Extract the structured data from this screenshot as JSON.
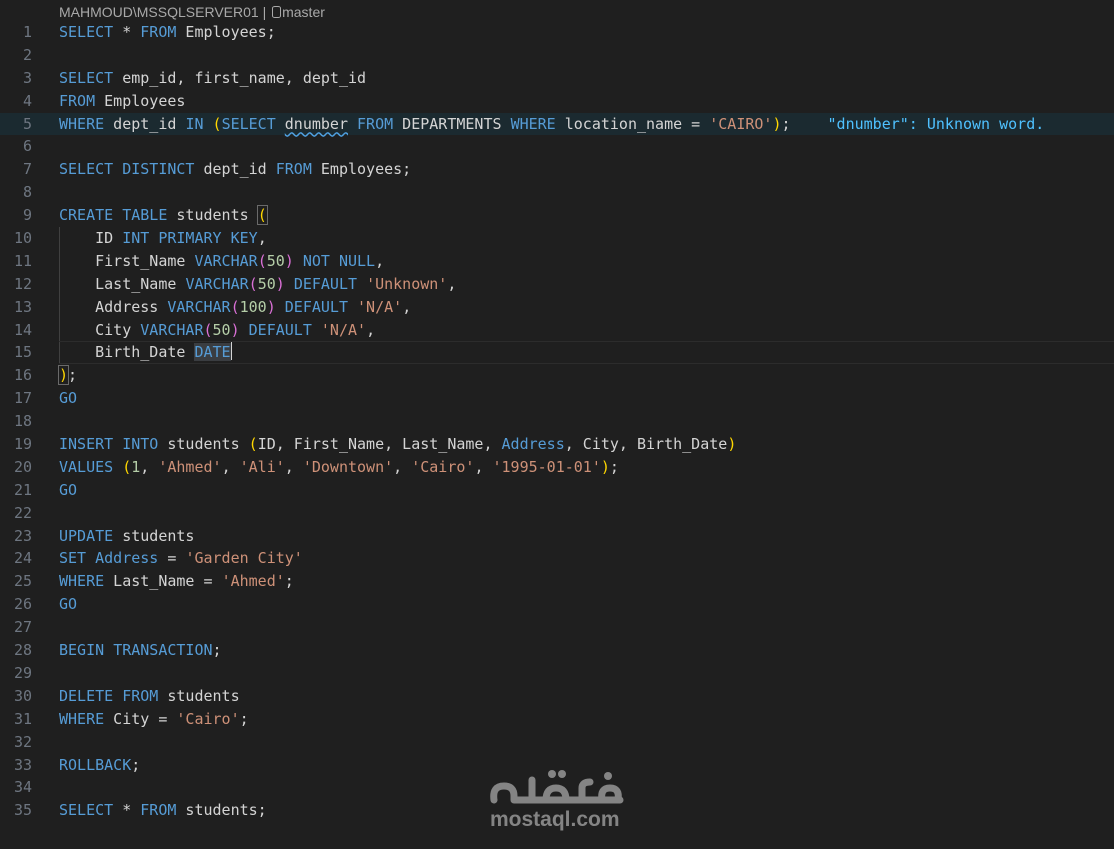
{
  "connection": {
    "server": "MAHMOUD\\MSSQLSERVER01",
    "separator": "|",
    "database": "master"
  },
  "watermark": {
    "brand_glyphs": "مستقل",
    "domain": "mostaql.com"
  },
  "editor": {
    "active_line": 5,
    "cursor_line": 15,
    "diagnostic": "\"dnumber\": Unknown word.",
    "lines": [
      {
        "n": "1",
        "tokens": [
          [
            "kw",
            "SELECT"
          ],
          [
            "op",
            " * "
          ],
          [
            "kw",
            "FROM"
          ],
          [
            "id",
            " Employees;"
          ]
        ]
      },
      {
        "n": "2",
        "tokens": []
      },
      {
        "n": "3",
        "tokens": [
          [
            "kw",
            "SELECT"
          ],
          [
            "id",
            " emp_id, first_name, dept_id"
          ]
        ]
      },
      {
        "n": "4",
        "tokens": [
          [
            "kw",
            "FROM"
          ],
          [
            "id",
            " Employees"
          ]
        ]
      },
      {
        "n": "5",
        "tokens": [
          [
            "kw",
            "WHERE"
          ],
          [
            "id",
            " dept_id "
          ],
          [
            "kw",
            "IN"
          ],
          [
            "op",
            " "
          ],
          [
            "br1",
            "("
          ],
          [
            "kw",
            "SELECT"
          ],
          [
            "op",
            " "
          ],
          [
            "squiggle",
            "dnumber"
          ],
          [
            "op",
            " "
          ],
          [
            "kw",
            "FROM"
          ],
          [
            "id",
            " DEPARTMENTS "
          ],
          [
            "kw",
            "WHERE"
          ],
          [
            "id",
            " location_name = "
          ],
          [
            "str",
            "'CAIRO'"
          ],
          [
            "br1",
            ")"
          ],
          [
            "op",
            ";"
          ]
        ],
        "diag": true
      },
      {
        "n": "6",
        "tokens": []
      },
      {
        "n": "7",
        "tokens": [
          [
            "kw",
            "SELECT"
          ],
          [
            "op",
            " "
          ],
          [
            "kw",
            "DISTINCT"
          ],
          [
            "id",
            " dept_id "
          ],
          [
            "kw",
            "FROM"
          ],
          [
            "id",
            " Employees;"
          ]
        ]
      },
      {
        "n": "8",
        "tokens": []
      },
      {
        "n": "9",
        "tokens": [
          [
            "kw",
            "CREATE"
          ],
          [
            "op",
            " "
          ],
          [
            "kw",
            "TABLE"
          ],
          [
            "id",
            " students "
          ],
          [
            "brmatch",
            "("
          ]
        ]
      },
      {
        "n": "10",
        "tokens": [
          [
            "op",
            "    "
          ],
          [
            "id",
            "ID "
          ],
          [
            "kw",
            "INT"
          ],
          [
            "op",
            " "
          ],
          [
            "kw",
            "PRIMARY"
          ],
          [
            "op",
            " "
          ],
          [
            "kw",
            "KEY"
          ],
          [
            "op",
            ","
          ]
        ],
        "guide": true
      },
      {
        "n": "11",
        "tokens": [
          [
            "op",
            "    "
          ],
          [
            "id",
            "First_Name "
          ],
          [
            "kw",
            "VARCHAR"
          ],
          [
            "br2",
            "("
          ],
          [
            "num",
            "50"
          ],
          [
            "br2",
            ")"
          ],
          [
            "op",
            " "
          ],
          [
            "kw",
            "NOT"
          ],
          [
            "op",
            " "
          ],
          [
            "kw",
            "NULL"
          ],
          [
            "op",
            ","
          ]
        ],
        "guide": true
      },
      {
        "n": "12",
        "tokens": [
          [
            "op",
            "    "
          ],
          [
            "id",
            "Last_Name "
          ],
          [
            "kw",
            "VARCHAR"
          ],
          [
            "br2",
            "("
          ],
          [
            "num",
            "50"
          ],
          [
            "br2",
            ")"
          ],
          [
            "op",
            " "
          ],
          [
            "kw",
            "DEFAULT"
          ],
          [
            "op",
            " "
          ],
          [
            "str",
            "'Unknown'"
          ],
          [
            "op",
            ","
          ]
        ],
        "guide": true
      },
      {
        "n": "13",
        "tokens": [
          [
            "op",
            "    "
          ],
          [
            "id",
            "Address "
          ],
          [
            "kw",
            "VARCHAR"
          ],
          [
            "br2",
            "("
          ],
          [
            "num",
            "100"
          ],
          [
            "br2",
            ")"
          ],
          [
            "op",
            " "
          ],
          [
            "kw",
            "DEFAULT"
          ],
          [
            "op",
            " "
          ],
          [
            "str",
            "'N/A'"
          ],
          [
            "op",
            ","
          ]
        ],
        "guide": true
      },
      {
        "n": "14",
        "tokens": [
          [
            "op",
            "    "
          ],
          [
            "id",
            "City "
          ],
          [
            "kw",
            "VARCHAR"
          ],
          [
            "br2",
            "("
          ],
          [
            "num",
            "50"
          ],
          [
            "br2",
            ")"
          ],
          [
            "op",
            " "
          ],
          [
            "kw",
            "DEFAULT"
          ],
          [
            "op",
            " "
          ],
          [
            "str",
            "'N/A'"
          ],
          [
            "op",
            ","
          ]
        ],
        "guide": true
      },
      {
        "n": "15",
        "tokens": [
          [
            "op",
            "    "
          ],
          [
            "id",
            "Birth_Date "
          ],
          [
            "sel",
            "DATE"
          ],
          [
            "caret",
            ""
          ]
        ],
        "guide": true
      },
      {
        "n": "16",
        "tokens": [
          [
            "brmatch",
            ")"
          ],
          [
            "op",
            ";"
          ]
        ]
      },
      {
        "n": "17",
        "tokens": [
          [
            "kw",
            "GO"
          ]
        ]
      },
      {
        "n": "18",
        "tokens": []
      },
      {
        "n": "19",
        "tokens": [
          [
            "kw",
            "INSERT"
          ],
          [
            "op",
            " "
          ],
          [
            "kw",
            "INTO"
          ],
          [
            "id",
            " students "
          ],
          [
            "br1",
            "("
          ],
          [
            "id",
            "ID, First_Name, Last_Name, "
          ],
          [
            "kw",
            "Address"
          ],
          [
            "id",
            ", City, Birth_Date"
          ],
          [
            "br1",
            ")"
          ]
        ]
      },
      {
        "n": "20",
        "tokens": [
          [
            "kw",
            "VALUES"
          ],
          [
            "op",
            " "
          ],
          [
            "br1",
            "("
          ],
          [
            "num",
            "1"
          ],
          [
            "op",
            ", "
          ],
          [
            "str",
            "'Ahmed'"
          ],
          [
            "op",
            ", "
          ],
          [
            "str",
            "'Ali'"
          ],
          [
            "op",
            ", "
          ],
          [
            "str",
            "'Downtown'"
          ],
          [
            "op",
            ", "
          ],
          [
            "str",
            "'Cairo'"
          ],
          [
            "op",
            ", "
          ],
          [
            "str",
            "'1995-01-01'"
          ],
          [
            "br1",
            ")"
          ],
          [
            "op",
            ";"
          ]
        ]
      },
      {
        "n": "21",
        "tokens": [
          [
            "kw",
            "GO"
          ]
        ]
      },
      {
        "n": "22",
        "tokens": []
      },
      {
        "n": "23",
        "tokens": [
          [
            "kw",
            "UPDATE"
          ],
          [
            "id",
            " students"
          ]
        ]
      },
      {
        "n": "24",
        "tokens": [
          [
            "kw",
            "SET"
          ],
          [
            "op",
            " "
          ],
          [
            "kw",
            "Address"
          ],
          [
            "op",
            " = "
          ],
          [
            "str",
            "'Garden City'"
          ]
        ]
      },
      {
        "n": "25",
        "tokens": [
          [
            "kw",
            "WHERE"
          ],
          [
            "id",
            " Last_Name = "
          ],
          [
            "str",
            "'Ahmed'"
          ],
          [
            "op",
            ";"
          ]
        ]
      },
      {
        "n": "26",
        "tokens": [
          [
            "kw",
            "GO"
          ]
        ]
      },
      {
        "n": "27",
        "tokens": []
      },
      {
        "n": "28",
        "tokens": [
          [
            "kw",
            "BEGIN"
          ],
          [
            "op",
            " "
          ],
          [
            "kw",
            "TRANSACTION"
          ],
          [
            "op",
            ";"
          ]
        ]
      },
      {
        "n": "29",
        "tokens": []
      },
      {
        "n": "30",
        "tokens": [
          [
            "kw",
            "DELETE"
          ],
          [
            "op",
            " "
          ],
          [
            "kw",
            "FROM"
          ],
          [
            "id",
            " students"
          ]
        ]
      },
      {
        "n": "31",
        "tokens": [
          [
            "kw",
            "WHERE"
          ],
          [
            "id",
            " City = "
          ],
          [
            "str",
            "'Cairo'"
          ],
          [
            "op",
            ";"
          ]
        ]
      },
      {
        "n": "32",
        "tokens": []
      },
      {
        "n": "33",
        "tokens": [
          [
            "kw",
            "ROLLBACK"
          ],
          [
            "op",
            ";"
          ]
        ]
      },
      {
        "n": "34",
        "tokens": []
      },
      {
        "n": "35",
        "tokens": [
          [
            "kw",
            "SELECT"
          ],
          [
            "op",
            " * "
          ],
          [
            "kw",
            "FROM"
          ],
          [
            "id",
            " students;"
          ]
        ]
      }
    ]
  }
}
